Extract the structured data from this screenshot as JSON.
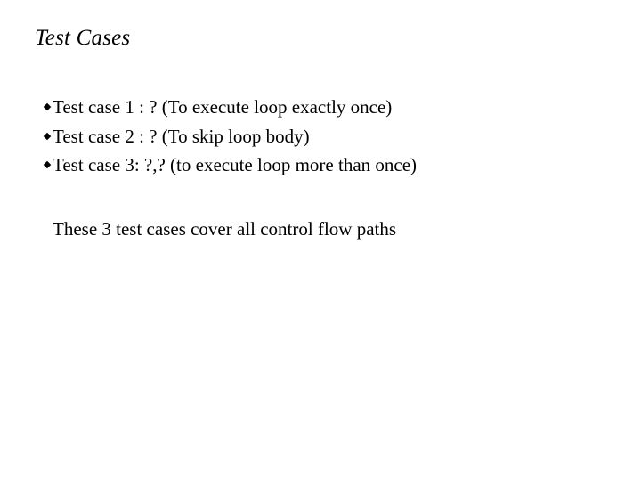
{
  "slide": {
    "title": "Test Cases",
    "bullets": [
      {
        "icon": "diamond-bullet-icon",
        "text": "Test case 1 : ? (To execute loop exactly once)"
      },
      {
        "icon": "diamond-bullet-icon",
        "text": "Test case 2 : ? (To skip loop body)"
      },
      {
        "icon": "diamond-bullet-icon",
        "text": "Test case 3: ?,? (to execute loop more than once)"
      }
    ],
    "summary": "These 3 test cases cover all control flow paths"
  }
}
